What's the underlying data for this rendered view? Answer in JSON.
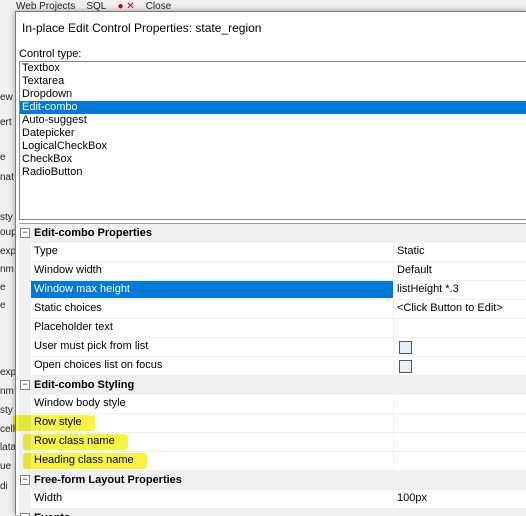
{
  "background": {
    "toolbar": [
      "Web Projects",
      "SQL",
      "Close"
    ],
    "left_fragments": [
      "ew",
      "ert",
      "e",
      "nat",
      "sty",
      "oup",
      "exp",
      "nm",
      "e",
      "e",
      "exp",
      "nm",
      "sty",
      "cell",
      "lata",
      "ue",
      "di"
    ]
  },
  "dialog": {
    "title": "In-place Edit Control Properties: state_region",
    "control_type_label": "Control type:",
    "control_types": [
      "Textbox",
      "Textarea",
      "Dropdown",
      "Edit-combo",
      "Auto-suggest",
      "Datepicker",
      "LogicalCheckBox",
      "CheckBox",
      "RadioButton"
    ],
    "selected_control_type": "Edit-combo"
  },
  "properties": [
    {
      "category": "Edit-combo Properties",
      "rows": [
        {
          "name": "Type",
          "value": "Static"
        },
        {
          "name": "Window width",
          "value": "Default"
        },
        {
          "name": "Window max height",
          "value": "listHeight *.3",
          "selected": true
        },
        {
          "name": "Static choices",
          "value": "<Click Button to Edit>"
        },
        {
          "name": "Placeholder text",
          "value": ""
        },
        {
          "name": "User must pick from list",
          "value": "",
          "checkbox": true
        },
        {
          "name": "Open choices list on focus",
          "value": "",
          "checkbox": true
        }
      ]
    },
    {
      "category": "Edit-combo Styling",
      "rows": [
        {
          "name": "Window body style",
          "value": ""
        },
        {
          "name": "Row style",
          "value": "",
          "highlighted": true
        },
        {
          "name": "Row class name",
          "value": "",
          "highlighted": true
        },
        {
          "name": "Heading class name",
          "value": "",
          "highlighted": true
        }
      ]
    },
    {
      "category": "Free-form Layout Properties",
      "rows": [
        {
          "name": "Width",
          "value": "100px"
        }
      ]
    },
    {
      "category": "Events",
      "rows": []
    }
  ],
  "colors": {
    "selection": "#0078d7",
    "highlighter": "#f2f000",
    "category_bg": "#f0f0f0"
  }
}
